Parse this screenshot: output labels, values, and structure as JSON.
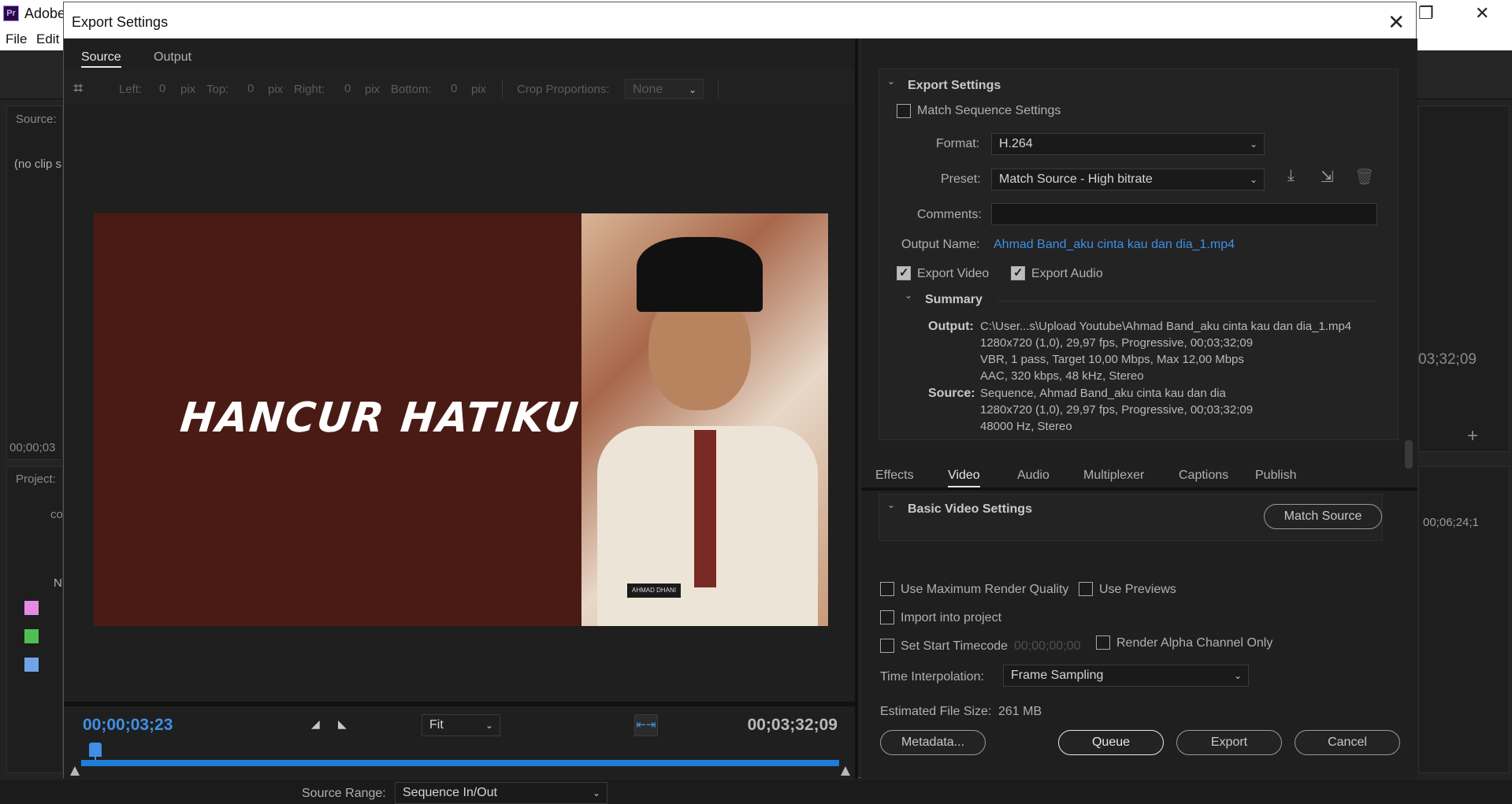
{
  "app": {
    "title": "Adobe",
    "menu": [
      "File",
      "Edit"
    ],
    "bg_source_label": "Source:",
    "bg_no_clip": "(no clip s",
    "bg_timecode_left": "00;00;03",
    "bg_project_label": "Project:",
    "bg_project_folder": "co",
    "bg_col_n": "N",
    "bg_timecode_right": "03;32;09",
    "bg_timecode_right2": "00;06;24;1",
    "bg_swatches": [
      "#e58be5",
      "#4fc04f",
      "#6fa4e6"
    ]
  },
  "dialog": {
    "title": "Export Settings",
    "close_icon": "close-icon",
    "left": {
      "tabs": [
        "Source",
        "Output"
      ],
      "active_tab": "Source",
      "crop": {
        "left_label": "Left:",
        "left_value": "0",
        "top_label": "Top:",
        "top_value": "0",
        "right_label": "Right:",
        "right_value": "0",
        "bottom_label": "Bottom:",
        "bottom_value": "0",
        "unit": "pix",
        "proportions_label": "Crop Proportions:",
        "proportions_value": "None"
      },
      "preview_title": "HANCUR HATIKU",
      "preview_name_tag": "AHMAD DHANI",
      "current_timecode": "00;00;03;23",
      "end_timecode": "00;03;32;09",
      "zoom": "Fit",
      "progress": 0.001,
      "source_range_label": "Source Range:",
      "source_range_value": "Sequence In/Out"
    },
    "right": {
      "export_settings_header": "Export Settings",
      "match_sequence_label": "Match Sequence Settings",
      "match_sequence_checked": false,
      "format_label": "Format:",
      "format_value": "H.264",
      "preset_label": "Preset:",
      "preset_value": "Match Source - High bitrate",
      "comments_label": "Comments:",
      "comments_value": "",
      "output_name_label": "Output Name:",
      "output_name_value": "Ahmad Band_aku cinta kau dan dia_1.mp4",
      "export_video_label": "Export Video",
      "export_video_checked": true,
      "export_audio_label": "Export Audio",
      "export_audio_checked": true,
      "summary_header": "Summary",
      "summary_output_label": "Output:",
      "summary_output_lines": [
        "C:\\User...s\\Upload Youtube\\Ahmad Band_aku cinta kau dan dia_1.mp4",
        "1280x720 (1,0), 29,97 fps, Progressive, 00;03;32;09",
        "VBR, 1 pass, Target 10,00 Mbps, Max 12,00 Mbps",
        "AAC, 320 kbps, 48 kHz, Stereo"
      ],
      "summary_source_label": "Source:",
      "summary_source_lines": [
        "Sequence, Ahmad Band_aku cinta kau dan dia",
        "1280x720 (1,0), 29,97 fps, Progressive, 00;03;32;09",
        "48000 Hz, Stereo"
      ],
      "tabs": [
        "Effects",
        "Video",
        "Audio",
        "Multiplexer",
        "Captions",
        "Publish"
      ],
      "active_tab": "Video",
      "basic_video_header": "Basic Video Settings",
      "match_source_button": "Match Source",
      "use_max_render_label": "Use Maximum Render Quality",
      "use_previews_label": "Use Previews",
      "import_project_label": "Import into project",
      "set_start_tc_label": "Set Start Timecode",
      "start_tc_value": "00;00;00;00",
      "render_alpha_label": "Render Alpha Channel Only",
      "time_interp_label": "Time Interpolation:",
      "time_interp_value": "Frame Sampling",
      "est_size_label": "Estimated File Size:",
      "est_size_value": "261 MB",
      "buttons": {
        "metadata": "Metadata...",
        "queue": "Queue",
        "export": "Export",
        "cancel": "Cancel"
      }
    }
  }
}
